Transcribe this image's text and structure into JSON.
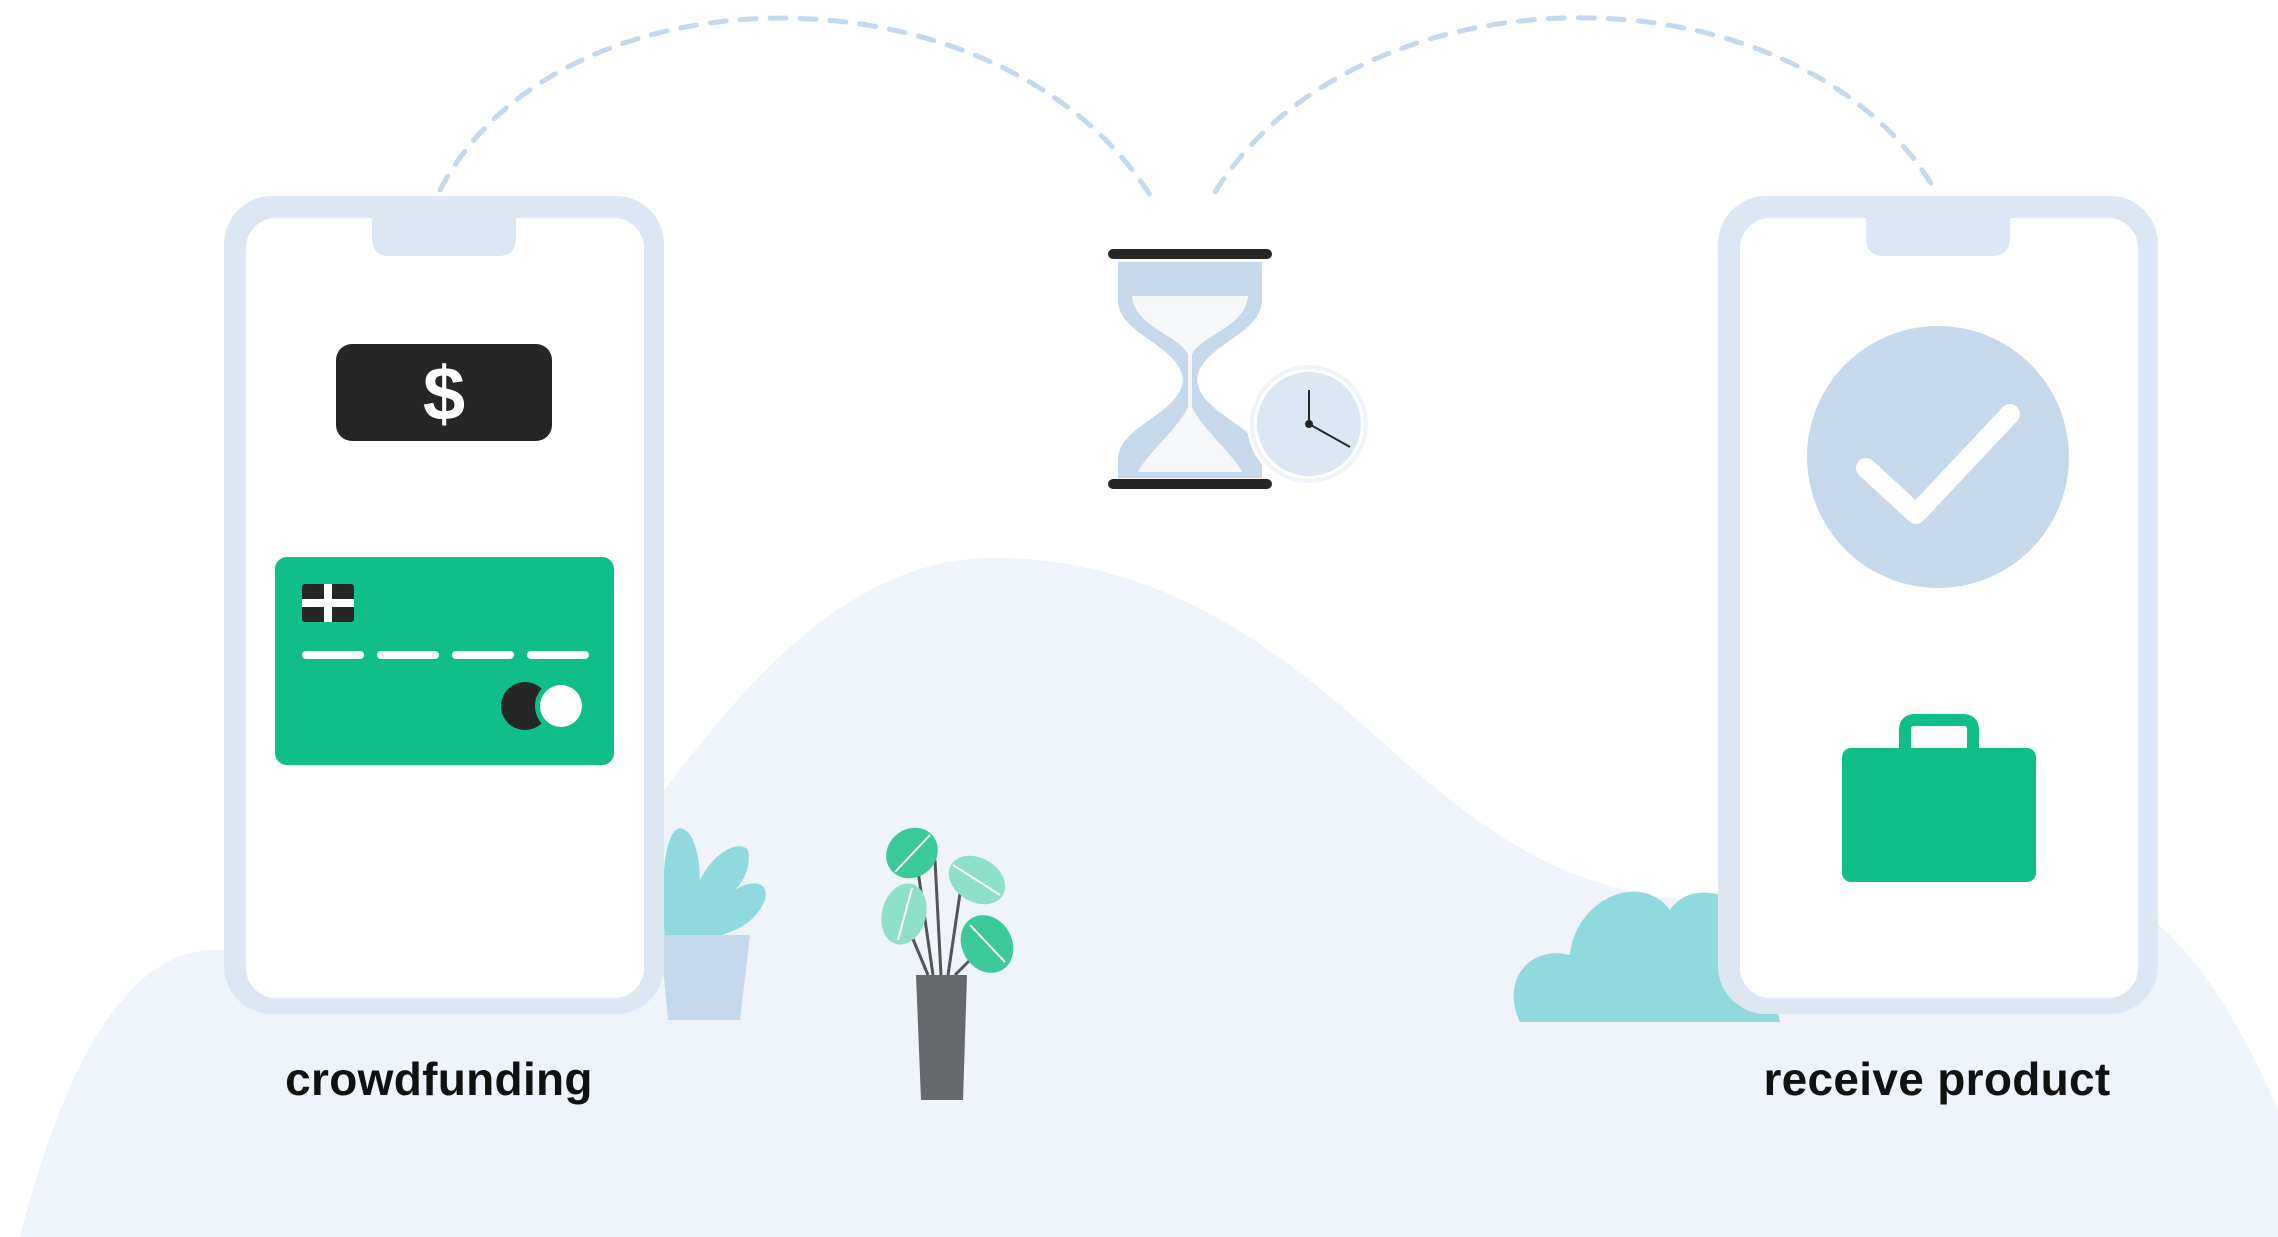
{
  "steps": [
    {
      "label": "crowdfunding",
      "icons": [
        "dollar-bill-icon",
        "credit-card-icon"
      ]
    },
    {
      "label": "",
      "icons": [
        "hourglass-icon",
        "clock-icon"
      ]
    },
    {
      "label": "receive product",
      "icons": [
        "checkmark-icon",
        "briefcase-icon"
      ]
    }
  ],
  "money_symbol": "$",
  "colors": {
    "background_hill": "#eff3fa",
    "phone_frame": "#dde7f3",
    "accent_green": "#0fbe88",
    "dark": "#262626",
    "light_blue": "#c5d8ec",
    "teal_plant": "#90d9df",
    "dashed_arc": "#c5d8ec"
  }
}
